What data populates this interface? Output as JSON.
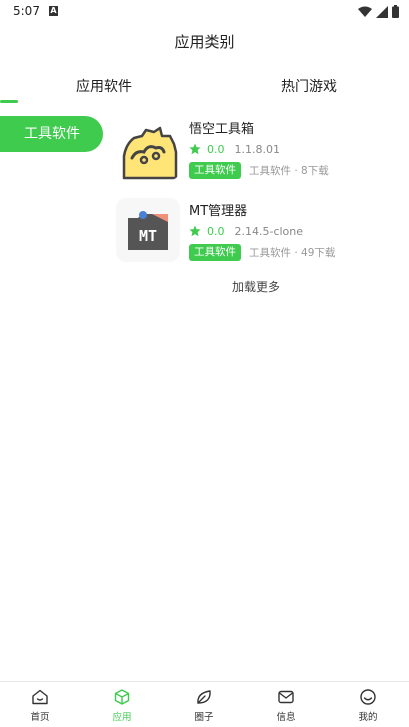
{
  "status_bar": {
    "time": "5:07",
    "icons": [
      "a-icon",
      "wifi-icon",
      "signal-icon",
      "battery-icon"
    ]
  },
  "header": {
    "title": "应用类别"
  },
  "tabs": [
    {
      "label": "应用软件",
      "active": true
    },
    {
      "label": "热门游戏",
      "active": false
    }
  ],
  "categories": [
    {
      "label": "工具软件",
      "active": true
    }
  ],
  "apps": [
    {
      "name": "悟空工具箱",
      "rating": "0.0",
      "version": "1.1.8.01",
      "badge": "工具软件",
      "meta": "工具软件 · 8下载",
      "icon": "wukong-cloud-icon"
    },
    {
      "name": "MT管理器",
      "rating": "0.0",
      "version": "2.14.5-clone",
      "badge": "工具软件",
      "meta": "工具软件 · 49下载",
      "icon": "mt-manager-icon"
    }
  ],
  "load_more": "加载更多",
  "bottom_nav": [
    {
      "label": "首页",
      "icon": "home-icon",
      "active": false
    },
    {
      "label": "应用",
      "icon": "cube-icon",
      "active": true
    },
    {
      "label": "圈子",
      "icon": "leaf-icon",
      "active": false
    },
    {
      "label": "信息",
      "icon": "mail-icon",
      "active": false
    },
    {
      "label": "我的",
      "icon": "smile-icon",
      "active": false
    }
  ],
  "colors": {
    "accent": "#3ecb4e",
    "text": "#222222",
    "muted": "#999999"
  }
}
